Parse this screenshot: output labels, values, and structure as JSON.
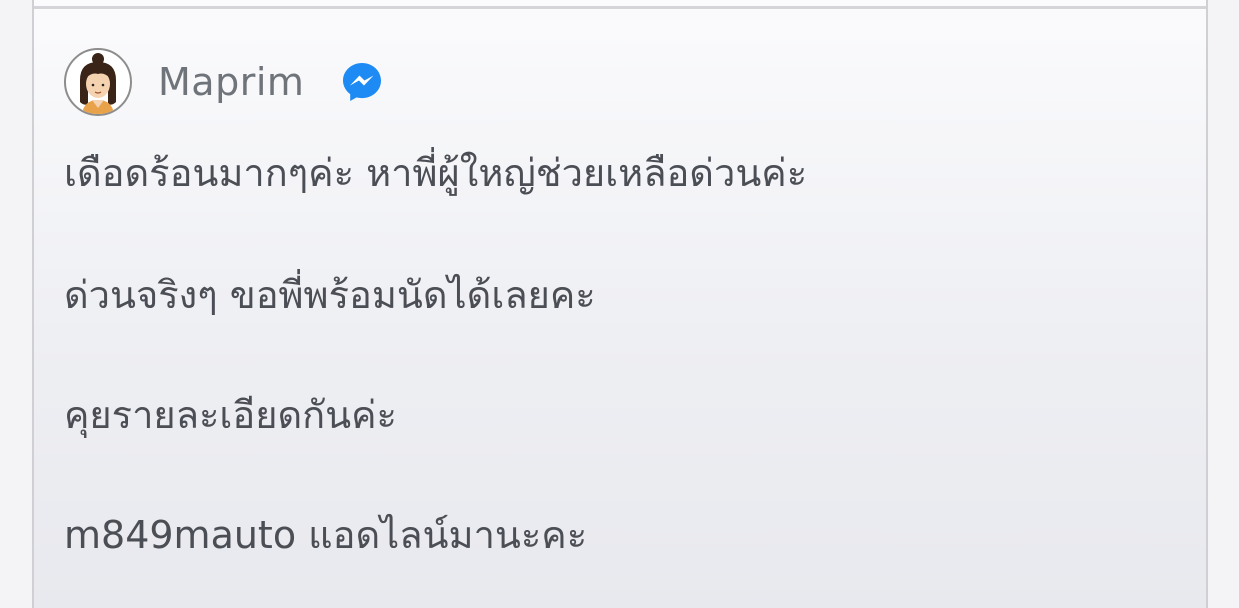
{
  "post": {
    "author": {
      "name": "Maprim",
      "avatar_icon": "user-avatar-icon",
      "messenger_icon": "messenger-icon"
    },
    "lines": [
      "เดือดร้อนมากๆค่ะ หาพี่ผู้ใหญ่ช่วยเหลือด่วนค่ะ",
      "ด่วนจริงๆ ขอพี่พร้อมนัดได้เลยคะ",
      "คุยรายละเอียดกันค่ะ",
      "m849mauto แอดไลน์มานะคะ"
    ]
  },
  "colors": {
    "messenger_blue": "#1e8bf5",
    "text": "#4b4e55",
    "name": "#6f737a"
  }
}
